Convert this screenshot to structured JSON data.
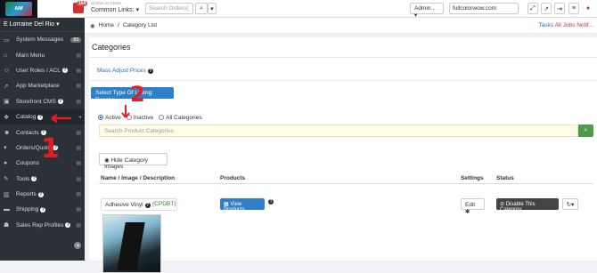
{
  "topbar": {
    "logo_text": "AIM",
    "notif_count": "164",
    "quick_access_label": "QUICK ACCESS",
    "common_links": "Common Links:",
    "search_orders_placeholder": "Search Orders(",
    "admin_label": "Admin...",
    "domain": "fullcolorwow.com"
  },
  "sidebar": {
    "user": "Lorraine Del Rio",
    "items": [
      {
        "label": "System Messages",
        "icon": "monitor-icon",
        "badge": "83"
      },
      {
        "label": "Main Menu",
        "icon": "home-icon"
      },
      {
        "label": "User Roles / ACL",
        "icon": "users-icon",
        "help": true
      },
      {
        "label": "App Marketplace",
        "icon": "rocket-icon"
      },
      {
        "label": "Storefront CMS",
        "icon": "desktop-icon",
        "help": true
      },
      {
        "label": "Catalog",
        "icon": "cubes-icon",
        "help": true
      },
      {
        "label": "Contacts",
        "icon": "contacts-icon",
        "help": true
      },
      {
        "label": "Orders/Quote",
        "icon": "cart-icon",
        "help": true
      },
      {
        "label": "Coupons",
        "icon": "tag-icon"
      },
      {
        "label": "Tools",
        "icon": "wrench-icon",
        "help": true
      },
      {
        "label": "Reports",
        "icon": "chart-icon",
        "help": true
      },
      {
        "label": "Shipping",
        "icon": "truck-icon",
        "help": true
      },
      {
        "label": "Sales Rep Profiles",
        "icon": "user-tie-icon",
        "help": true
      }
    ]
  },
  "breadcrumb": {
    "home": "Home",
    "separator": "/",
    "current": "Category List",
    "tasks": "Tasks",
    "alert": "All Jobs Notif..."
  },
  "main": {
    "title": "Categories",
    "mass_adjust": "Mass Adjust Prices",
    "select_type": "Select Type Of Listing: Reset",
    "radio_active": "Active",
    "radio_inactive": "Inactive",
    "radio_all": "All Categories",
    "search_placeholder": "Search Product Categories",
    "hide_images": "Hide Category Images",
    "table": {
      "headers": [
        "Name / Image / Description",
        "Products",
        "Settings",
        "Status"
      ],
      "row": {
        "name": "Adhesive Vinyl",
        "code": "(CPDBT)",
        "view_products": "View Products",
        "edit": "Edit",
        "disable": "Disable This Category"
      }
    }
  },
  "annotations": {
    "one": "1",
    "two": "2"
  }
}
